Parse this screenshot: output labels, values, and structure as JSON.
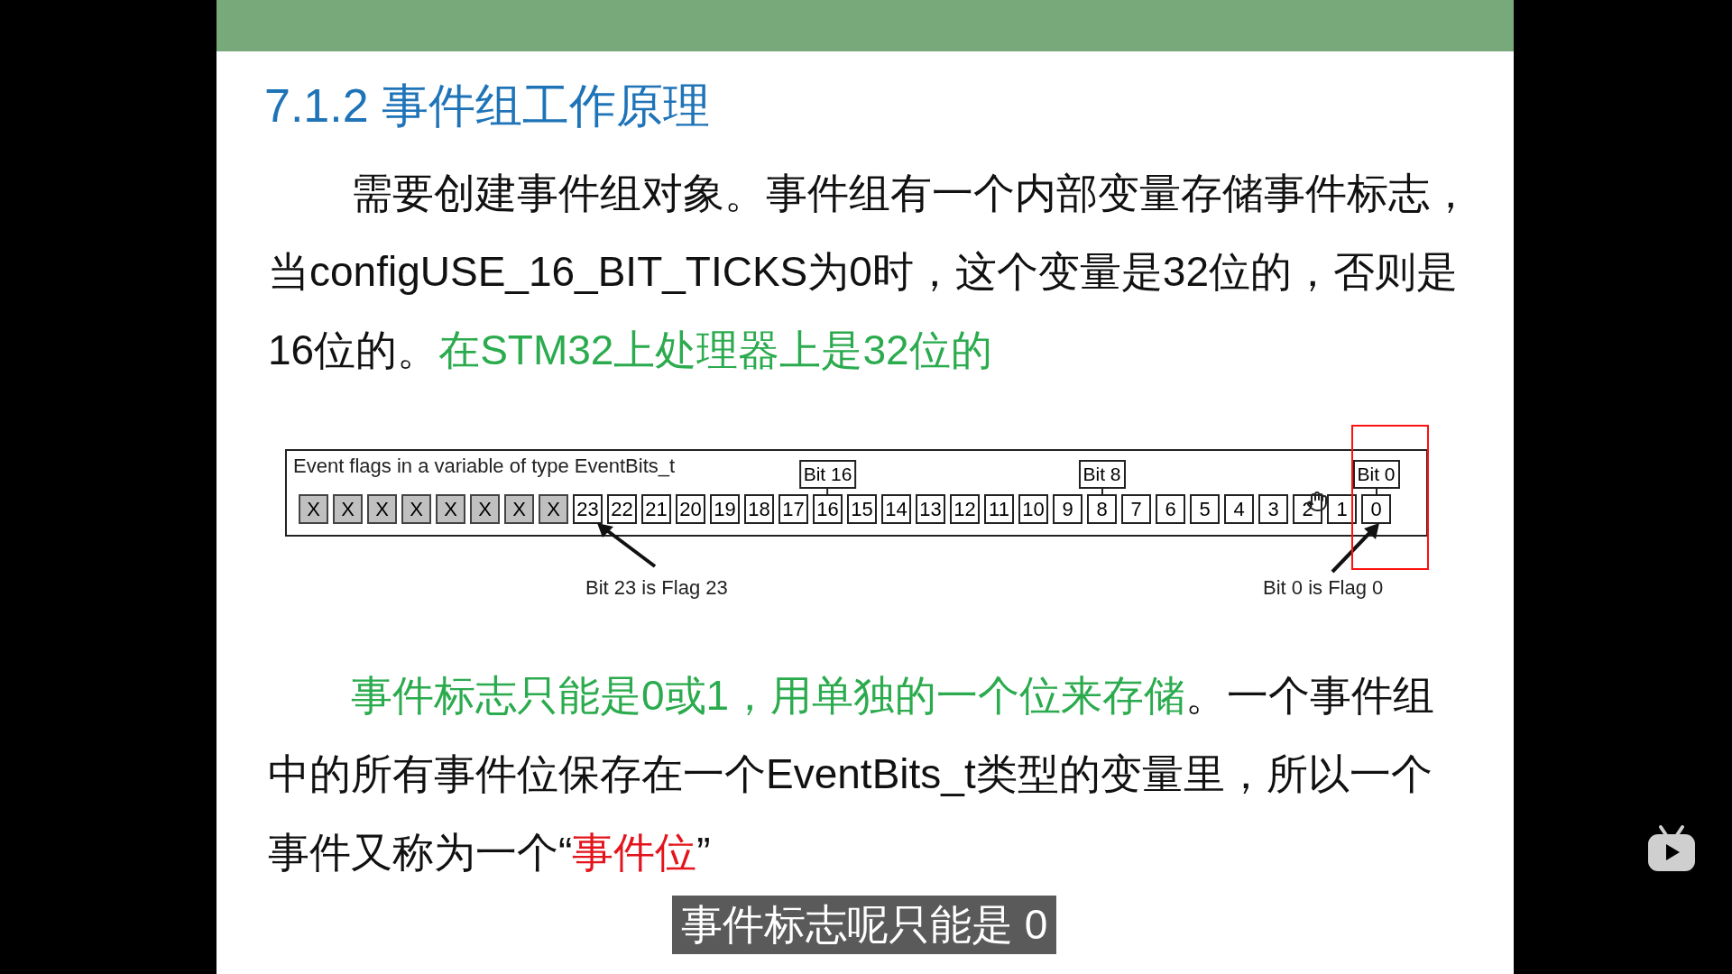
{
  "slide": {
    "title": "7.1.2 事件组工作原理",
    "paragraph_1": [
      {
        "text": "需要创建事件组对象。事件组有一个内部变量存储事件标志，当configUSE_16_BIT_TICKS为0时，这个变量是32位的，否则是16位的。",
        "color": "#111111"
      },
      {
        "text": "在STM32上处理器上是32位的",
        "color": "#2bab4e"
      }
    ],
    "diagram": {
      "caption": "Event flags in a variable of type EventBits_t",
      "cells": [
        {
          "label": "X",
          "kind": "unused"
        },
        {
          "label": "X",
          "kind": "unused"
        },
        {
          "label": "X",
          "kind": "unused"
        },
        {
          "label": "X",
          "kind": "unused"
        },
        {
          "label": "X",
          "kind": "unused"
        },
        {
          "label": "X",
          "kind": "unused"
        },
        {
          "label": "X",
          "kind": "unused"
        },
        {
          "label": "X",
          "kind": "unused"
        },
        {
          "label": "23",
          "kind": "flag"
        },
        {
          "label": "22",
          "kind": "flag"
        },
        {
          "label": "21",
          "kind": "flag"
        },
        {
          "label": "20",
          "kind": "flag"
        },
        {
          "label": "19",
          "kind": "flag"
        },
        {
          "label": "18",
          "kind": "flag"
        },
        {
          "label": "17",
          "kind": "flag"
        },
        {
          "label": "16",
          "kind": "flag",
          "marker": "Bit 16"
        },
        {
          "label": "15",
          "kind": "flag"
        },
        {
          "label": "14",
          "kind": "flag"
        },
        {
          "label": "13",
          "kind": "flag"
        },
        {
          "label": "12",
          "kind": "flag"
        },
        {
          "label": "11",
          "kind": "flag"
        },
        {
          "label": "10",
          "kind": "flag"
        },
        {
          "label": "9",
          "kind": "flag"
        },
        {
          "label": "8",
          "kind": "flag",
          "marker": "Bit 8"
        },
        {
          "label": "7",
          "kind": "flag"
        },
        {
          "label": "6",
          "kind": "flag"
        },
        {
          "label": "5",
          "kind": "flag"
        },
        {
          "label": "4",
          "kind": "flag"
        },
        {
          "label": "3",
          "kind": "flag"
        },
        {
          "label": "2",
          "kind": "flag"
        },
        {
          "label": "1",
          "kind": "flag"
        },
        {
          "label": "0",
          "kind": "flag",
          "marker": "Bit 0"
        }
      ],
      "callouts": [
        "Bit 23 is Flag 23",
        "Bit 0 is Flag 0"
      ]
    },
    "paragraph_2": [
      {
        "text": "事件标志只能是0或1，用单独的一个位来存储",
        "color": "#2bab4e"
      },
      {
        "text": "。一个事件组中的所有事件位保存在一个EventBits_t类型的变量里，所以一个事件又称为一个“",
        "color": "#111111"
      },
      {
        "text": "事件位",
        "color": "#e3141c"
      },
      {
        "text": "”",
        "color": "#111111"
      }
    ]
  },
  "subtitle": "事件标志呢只能是 0"
}
